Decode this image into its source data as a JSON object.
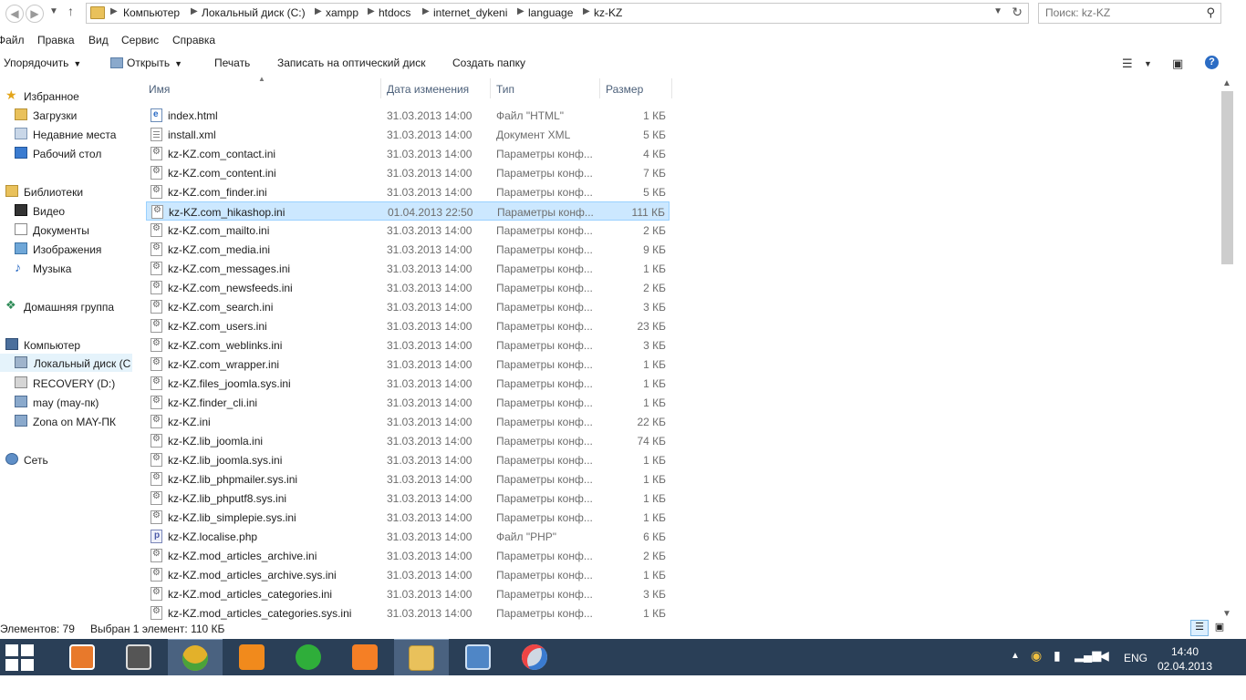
{
  "address": {
    "crumbs": [
      "Компьютер",
      "Локальный диск (C:)",
      "xampp",
      "htdocs",
      "internet_dykeni",
      "language",
      "kz-KZ"
    ],
    "search_placeholder": "Поиск: kz-KZ"
  },
  "menu": [
    "Файл",
    "Правка",
    "Вид",
    "Сервис",
    "Справка"
  ],
  "toolbar": {
    "organize": "Упорядочить",
    "open": "Открыть",
    "print": "Печать",
    "burn": "Записать на оптический диск",
    "new_folder": "Создать папку"
  },
  "nav": {
    "favorites": "Избранное",
    "downloads": "Загрузки",
    "recent": "Недавние места",
    "desktop": "Рабочий стол",
    "libraries": "Библиотеки",
    "video": "Видео",
    "documents": "Документы",
    "images": "Изображения",
    "music": "Музыка",
    "homegroup": "Домашняя группа",
    "computer": "Компьютер",
    "local_disk": "Локальный диск (C",
    "recovery": "RECOVERY (D:)",
    "may": "may (may-пк)",
    "zona": "Zona on MAY-ПК",
    "network": "Сеть"
  },
  "columns": {
    "name": "Имя",
    "date": "Дата изменения",
    "type": "Тип",
    "size": "Размер"
  },
  "files": [
    {
      "name": "index.html",
      "date": "31.03.2013 14:00",
      "type": "Файл \"HTML\"",
      "size": "1 КБ",
      "icon": "htm"
    },
    {
      "name": "install.xml",
      "date": "31.03.2013 14:00",
      "type": "Документ XML",
      "size": "5 КБ",
      "icon": "doc"
    },
    {
      "name": "kz-KZ.com_contact.ini",
      "date": "31.03.2013 14:00",
      "type": "Параметры конф...",
      "size": "4 КБ",
      "icon": "cfg"
    },
    {
      "name": "kz-KZ.com_content.ini",
      "date": "31.03.2013 14:00",
      "type": "Параметры конф...",
      "size": "7 КБ",
      "icon": "cfg"
    },
    {
      "name": "kz-KZ.com_finder.ini",
      "date": "31.03.2013 14:00",
      "type": "Параметры конф...",
      "size": "5 КБ",
      "icon": "cfg"
    },
    {
      "name": "kz-KZ.com_hikashop.ini",
      "date": "01.04.2013 22:50",
      "type": "Параметры конф...",
      "size": "111 КБ",
      "icon": "cfg",
      "selected": true
    },
    {
      "name": "kz-KZ.com_mailto.ini",
      "date": "31.03.2013 14:00",
      "type": "Параметры конф...",
      "size": "2 КБ",
      "icon": "cfg"
    },
    {
      "name": "kz-KZ.com_media.ini",
      "date": "31.03.2013 14:00",
      "type": "Параметры конф...",
      "size": "9 КБ",
      "icon": "cfg"
    },
    {
      "name": "kz-KZ.com_messages.ini",
      "date": "31.03.2013 14:00",
      "type": "Параметры конф...",
      "size": "1 КБ",
      "icon": "cfg"
    },
    {
      "name": "kz-KZ.com_newsfeeds.ini",
      "date": "31.03.2013 14:00",
      "type": "Параметры конф...",
      "size": "2 КБ",
      "icon": "cfg"
    },
    {
      "name": "kz-KZ.com_search.ini",
      "date": "31.03.2013 14:00",
      "type": "Параметры конф...",
      "size": "3 КБ",
      "icon": "cfg"
    },
    {
      "name": "kz-KZ.com_users.ini",
      "date": "31.03.2013 14:00",
      "type": "Параметры конф...",
      "size": "23 КБ",
      "icon": "cfg"
    },
    {
      "name": "kz-KZ.com_weblinks.ini",
      "date": "31.03.2013 14:00",
      "type": "Параметры конф...",
      "size": "3 КБ",
      "icon": "cfg"
    },
    {
      "name": "kz-KZ.com_wrapper.ini",
      "date": "31.03.2013 14:00",
      "type": "Параметры конф...",
      "size": "1 КБ",
      "icon": "cfg"
    },
    {
      "name": "kz-KZ.files_joomla.sys.ini",
      "date": "31.03.2013 14:00",
      "type": "Параметры конф...",
      "size": "1 КБ",
      "icon": "cfg"
    },
    {
      "name": "kz-KZ.finder_cli.ini",
      "date": "31.03.2013 14:00",
      "type": "Параметры конф...",
      "size": "1 КБ",
      "icon": "cfg"
    },
    {
      "name": "kz-KZ.ini",
      "date": "31.03.2013 14:00",
      "type": "Параметры конф...",
      "size": "22 КБ",
      "icon": "cfg"
    },
    {
      "name": "kz-KZ.lib_joomla.ini",
      "date": "31.03.2013 14:00",
      "type": "Параметры конф...",
      "size": "74 КБ",
      "icon": "cfg"
    },
    {
      "name": "kz-KZ.lib_joomla.sys.ini",
      "date": "31.03.2013 14:00",
      "type": "Параметры конф...",
      "size": "1 КБ",
      "icon": "cfg"
    },
    {
      "name": "kz-KZ.lib_phpmailer.sys.ini",
      "date": "31.03.2013 14:00",
      "type": "Параметры конф...",
      "size": "1 КБ",
      "icon": "cfg"
    },
    {
      "name": "kz-KZ.lib_phputf8.sys.ini",
      "date": "31.03.2013 14:00",
      "type": "Параметры конф...",
      "size": "1 КБ",
      "icon": "cfg"
    },
    {
      "name": "kz-KZ.lib_simplepie.sys.ini",
      "date": "31.03.2013 14:00",
      "type": "Параметры конф...",
      "size": "1 КБ",
      "icon": "cfg"
    },
    {
      "name": "kz-KZ.localise.php",
      "date": "31.03.2013 14:00",
      "type": "Файл \"PHP\"",
      "size": "6 КБ",
      "icon": "php"
    },
    {
      "name": "kz-KZ.mod_articles_archive.ini",
      "date": "31.03.2013 14:00",
      "type": "Параметры конф...",
      "size": "2 КБ",
      "icon": "cfg"
    },
    {
      "name": "kz-KZ.mod_articles_archive.sys.ini",
      "date": "31.03.2013 14:00",
      "type": "Параметры конф...",
      "size": "1 КБ",
      "icon": "cfg"
    },
    {
      "name": "kz-KZ.mod_articles_categories.ini",
      "date": "31.03.2013 14:00",
      "type": "Параметры конф...",
      "size": "3 КБ",
      "icon": "cfg"
    },
    {
      "name": "kz-KZ.mod_articles_categories.sys.ini",
      "date": "31.03.2013 14:00",
      "type": "Параметры конф...",
      "size": "1 КБ",
      "icon": "cfg"
    }
  ],
  "status": {
    "count": "Элементов: 79",
    "selected": "Выбран 1 элемент: 110 КБ"
  },
  "taskbar": {
    "lang": "ENG",
    "time": "14:40",
    "date": "02.04.2013"
  },
  "colors": {
    "selection_bg": "#cce8ff",
    "selection_border": "#99d1ff",
    "taskbar": "#2a3f57"
  }
}
